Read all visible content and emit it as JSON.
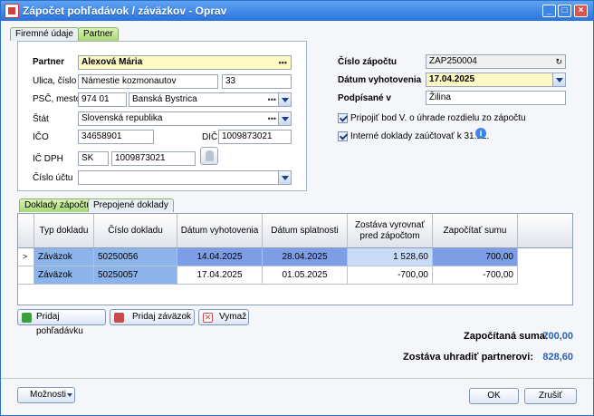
{
  "window": {
    "title": "Zápočet pohľadávok / záväzkov - Oprav"
  },
  "top_tabs": [
    "Firemné údaje",
    "Partner"
  ],
  "partner": {
    "partner_label": "Partner",
    "partner_value": "Alexová Mária",
    "street_label": "Ulica, číslo",
    "street_value": "Námestie kozmonautov",
    "number_value": "33",
    "zip_label": "PSČ, mesto",
    "zip_value": "974 01",
    "city_value": "Banská Bystrica",
    "country_label": "Štát",
    "country_value": "Slovenská republika",
    "ico_label": "IČO",
    "ico_value": "34658901",
    "dic_label": "DIČ",
    "dic_value": "1009873021",
    "icdph_label": "IČ DPH",
    "icdph_prefix": "SK",
    "icdph_value": "1009873021",
    "account_label": "Číslo účtu",
    "account_value": ""
  },
  "right": {
    "number_label": "Číslo zápočtu",
    "number_value": "ZAP250004",
    "date_label": "Dátum vyhotovenia",
    "date_value": "17.04.2025",
    "signed_label": "Podpísané v",
    "signed_value": "Žilina",
    "check1": "Pripojiť bod V. o úhrade rozdielu zo zápočtu",
    "check2": "Interné doklady zaúčtovať k 31.12.",
    "check1_checked": true,
    "check2_checked": true
  },
  "bottom_tabs": [
    "Doklady zápočtu",
    "Prepojené doklady"
  ],
  "grid": {
    "headers": [
      "Typ dokladu",
      "Číslo dokladu",
      "Dátum vyhotovenia",
      "Dátum splatnosti",
      "Zostáva vyrovnať pred zápočtom",
      "Započítať sumu"
    ],
    "rows": [
      [
        "Záväzok",
        "50250056",
        "14.04.2025",
        "28.04.2025",
        "1 528,60",
        "700,00"
      ],
      [
        "Záväzok",
        "50250057",
        "17.04.2025",
        "01.05.2025",
        "-700,00",
        "-700,00"
      ]
    ],
    "current_row_marker": ">"
  },
  "actions": {
    "add_receivable": "Pridaj pohľadávku",
    "add_payable": "Pridaj záväzok",
    "delete": "Vymaž"
  },
  "summary": {
    "counted_label": "Započítaná suma:",
    "counted_value": "700,00",
    "remaining_label": "Zostáva uhradiť partnerovi:",
    "remaining_value": "828,60"
  },
  "footer": {
    "options": "Možnosti",
    "ok": "OK",
    "cancel": "Zrušiť"
  },
  "colors": {
    "accent": "#2a73dc",
    "tab_active": "#a8d873",
    "highlight": "#8db4ea",
    "selected_cell": "#7d9ee6",
    "required": "#fff9c4"
  }
}
